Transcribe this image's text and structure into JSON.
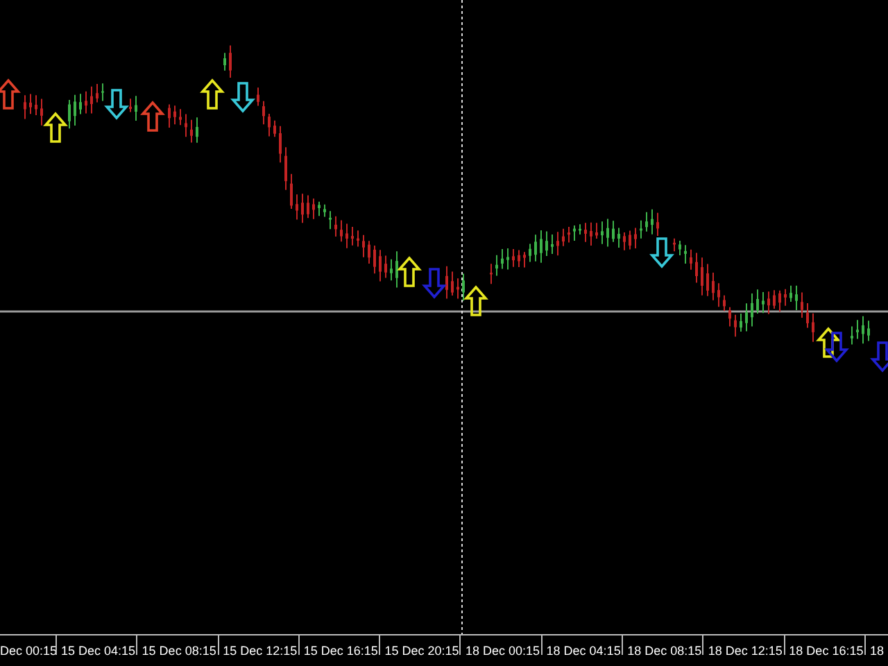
{
  "chart": {
    "signals": [
      {
        "kind": "up",
        "color": "#e0402a"
      },
      {
        "kind": "up",
        "color": "#e6e620"
      },
      {
        "kind": "down",
        "color": "#38c8d8"
      },
      {
        "kind": "up",
        "color": "#e0402a"
      },
      {
        "kind": "up",
        "color": "#e6e620"
      },
      {
        "kind": "down",
        "color": "#38c8d8"
      },
      {
        "kind": "up",
        "color": "#e6e620"
      },
      {
        "kind": "down",
        "color": "#2020d0"
      },
      {
        "kind": "up",
        "color": "#e6e620"
      },
      {
        "kind": "down",
        "color": "#38c8d8"
      },
      {
        "kind": "up",
        "color": "#e6e620"
      },
      {
        "kind": "down",
        "color": "#2020d0"
      },
      {
        "kind": "down",
        "color": "#2020d0"
      }
    ]
  },
  "time_axis": {
    "labels": [
      "Dec 00:15",
      "15 Dec 04:15",
      "15 Dec 08:15",
      "15 Dec 12:15",
      "15 Dec 16:15",
      "15 Dec 20:15",
      "18 Dec 00:15",
      "18 Dec 04:15",
      "18 Dec 08:15",
      "18 Dec 12:15",
      "18 Dec 16:15",
      "18"
    ]
  }
}
